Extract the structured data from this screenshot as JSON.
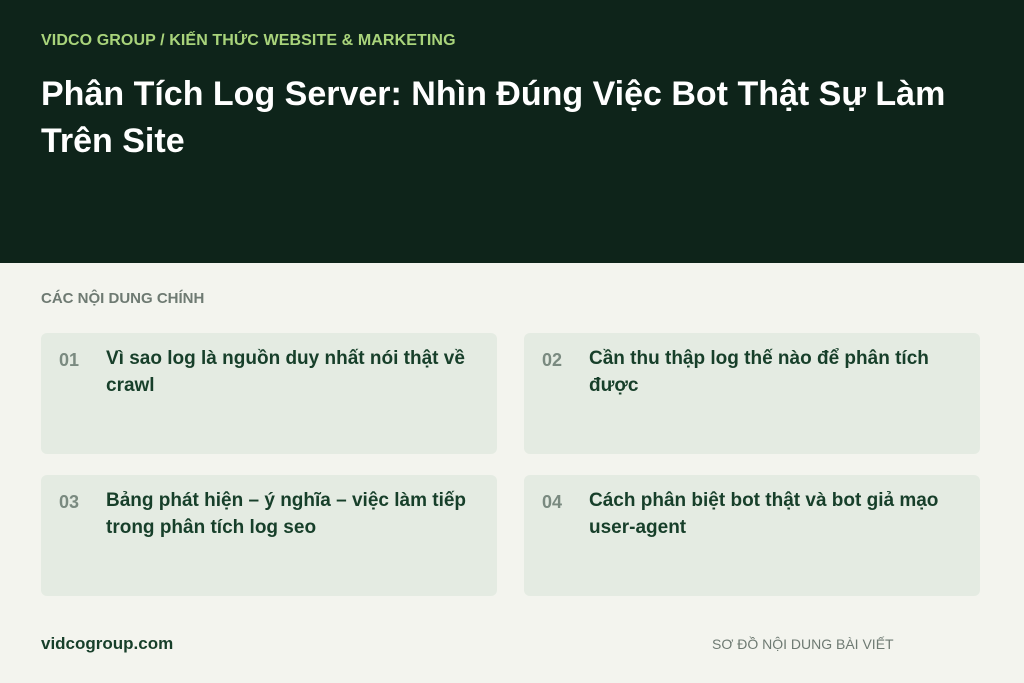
{
  "header": {
    "breadcrumb": "VIDCO GROUP / KIẾN THỨC WEBSITE & MARKETING",
    "title": "Phân Tích Log Server: Nhìn Đúng Việc Bot Thật Sự Làm Trên Site"
  },
  "section": {
    "label": "CÁC NỘI DUNG CHÍNH",
    "items": [
      {
        "number": "01",
        "text": "Vì sao log là nguồn duy nhất nói thật về crawl"
      },
      {
        "number": "02",
        "text": "Cần thu thập log thế nào để phân tích được"
      },
      {
        "number": "03",
        "text": "Bảng phát hiện – ý nghĩa – việc làm tiếp trong phân tích log seo"
      },
      {
        "number": "04",
        "text": "Cách phân biệt bot thật và bot giả mạo user-agent"
      }
    ]
  },
  "footer": {
    "site": "vidcogroup.com",
    "note": "SƠ ĐỒ NỘI DUNG BÀI VIẾT"
  }
}
